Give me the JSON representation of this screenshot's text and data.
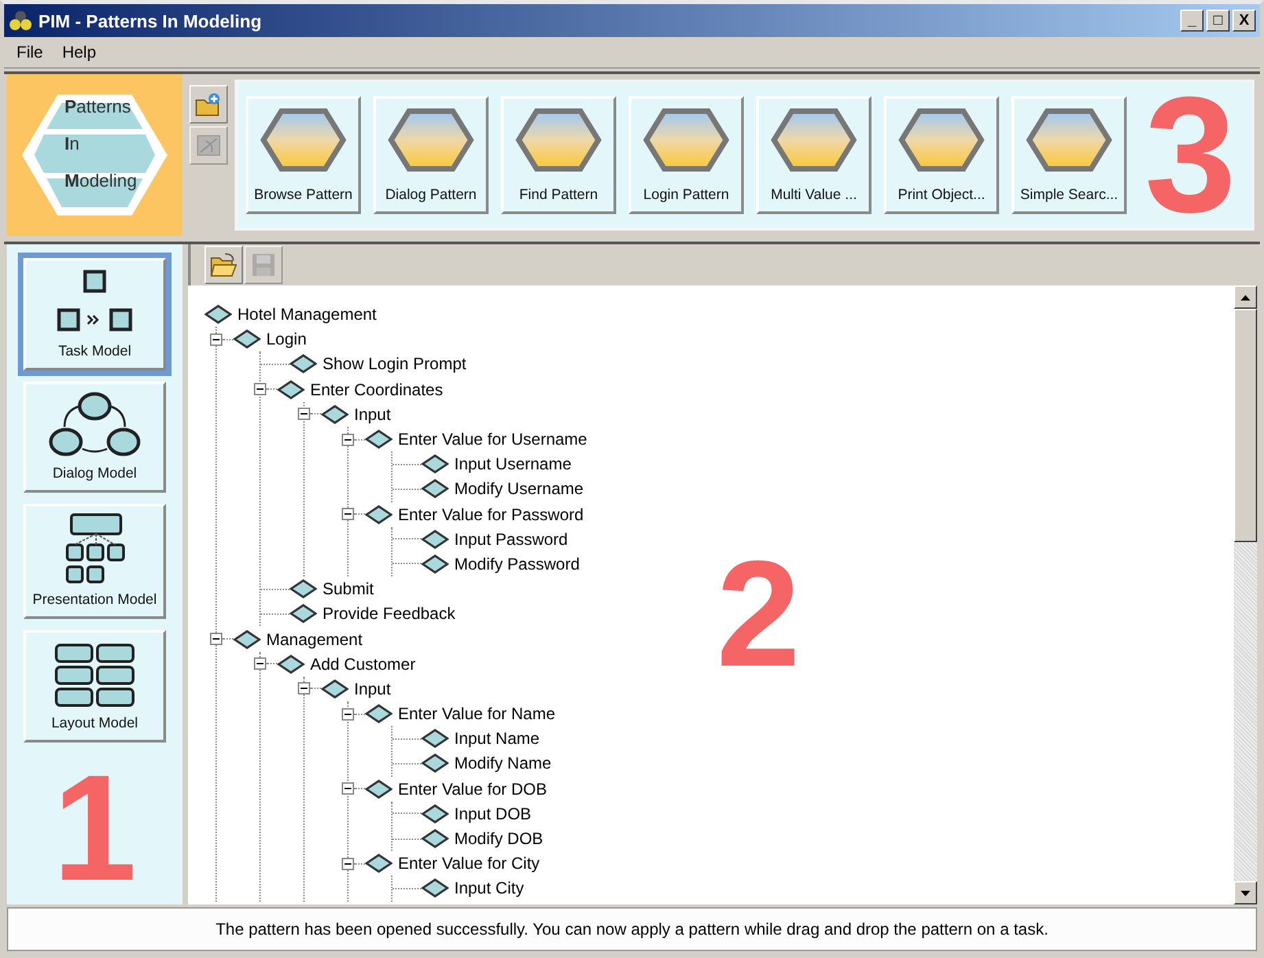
{
  "window": {
    "title": "PIM - Patterns In Modeling",
    "controls": [
      "_",
      "□",
      "X"
    ]
  },
  "menu": [
    {
      "label": "File"
    },
    {
      "label": "Help"
    }
  ],
  "logo": {
    "lines": [
      "**P**atterns",
      "**I**n",
      "**M**odeling"
    ]
  },
  "pattern_toolbar": [
    {
      "kind": "open-add",
      "disabled": false
    },
    {
      "kind": "remove",
      "disabled": true
    }
  ],
  "patterns": [
    {
      "label": "Browse Pattern"
    },
    {
      "label": "Dialog Pattern"
    },
    {
      "label": "Find Pattern"
    },
    {
      "label": "Login Pattern"
    },
    {
      "label": "Multi Value ..."
    },
    {
      "label": "Print Object..."
    },
    {
      "label": "Simple Searc..."
    }
  ],
  "models": [
    {
      "label": "Task Model",
      "kind": "task",
      "selected": true
    },
    {
      "label": "Dialog Model",
      "kind": "dialog",
      "selected": false
    },
    {
      "label": "Presentation Model",
      "kind": "presentation",
      "selected": false
    },
    {
      "label": "Layout Model",
      "kind": "layout",
      "selected": false
    }
  ],
  "tree_toolbar": [
    {
      "kind": "open",
      "disabled": false
    },
    {
      "kind": "save",
      "disabled": true
    }
  ],
  "tree": [
    {
      "label": "Hotel Management",
      "children": [
        {
          "label": "Login",
          "expanded": true,
          "children": [
            {
              "label": "Show Login Prompt"
            },
            {
              "label": "Enter Coordinates",
              "expanded": true,
              "children": [
                {
                  "label": "Input",
                  "expanded": true,
                  "children": [
                    {
                      "label": "Enter Value for Username",
                      "expanded": true,
                      "children": [
                        {
                          "label": "Input Username"
                        },
                        {
                          "label": "Modify Username"
                        }
                      ]
                    },
                    {
                      "label": "Enter Value for Password",
                      "expanded": true,
                      "children": [
                        {
                          "label": "Input Password"
                        },
                        {
                          "label": "Modify Password"
                        }
                      ]
                    }
                  ]
                }
              ]
            },
            {
              "label": "Submit"
            },
            {
              "label": "Provide Feedback"
            }
          ]
        },
        {
          "label": "Management",
          "expanded": true,
          "children": [
            {
              "label": "Add Customer",
              "expanded": true,
              "children": [
                {
                  "label": "Input",
                  "expanded": true,
                  "children": [
                    {
                      "label": "Enter Value for Name",
                      "expanded": true,
                      "children": [
                        {
                          "label": "Input Name"
                        },
                        {
                          "label": "Modify Name"
                        }
                      ]
                    },
                    {
                      "label": "Enter Value for DOB",
                      "expanded": true,
                      "children": [
                        {
                          "label": "Input DOB"
                        },
                        {
                          "label": "Modify DOB"
                        }
                      ]
                    },
                    {
                      "label": "Enter Value for City",
                      "expanded": true,
                      "children": [
                        {
                          "label": "Input City"
                        }
                      ]
                    }
                  ]
                }
              ]
            }
          ]
        }
      ]
    }
  ],
  "annotations": [
    "1",
    "2",
    "3"
  ],
  "status_bar": "The pattern has been opened successfully. You can now apply a pattern while drag and drop the pattern on a task."
}
